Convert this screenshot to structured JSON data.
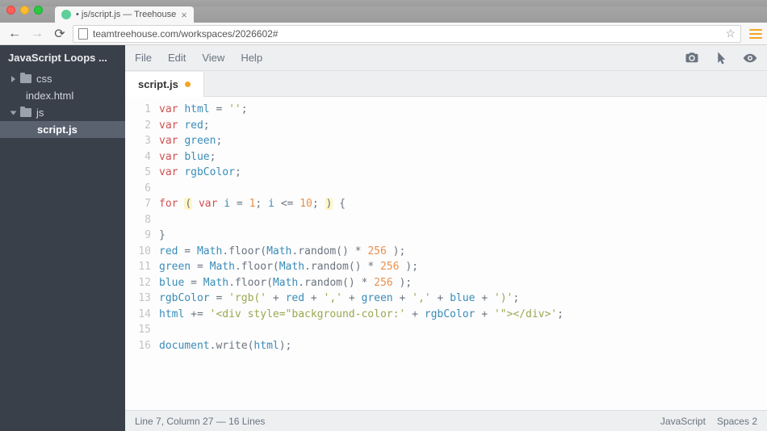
{
  "browser": {
    "tab_title": "• js/script.js — Treehouse",
    "url": "teamtreehouse.com/workspaces/2026602#"
  },
  "sidebar": {
    "project_name": "JavaScript Loops ...",
    "items": [
      {
        "label": "css",
        "type": "folder",
        "open": false
      },
      {
        "label": "index.html",
        "type": "file"
      },
      {
        "label": "js",
        "type": "folder",
        "open": true
      },
      {
        "label": "script.js",
        "type": "file",
        "nested": true,
        "selected": true
      }
    ]
  },
  "menubar": {
    "file": "File",
    "edit": "Edit",
    "view": "View",
    "help": "Help"
  },
  "file_tab": {
    "name": "script.js",
    "dirty": true
  },
  "code": {
    "lines": [
      [
        {
          "t": "var ",
          "c": "kw"
        },
        {
          "t": "html",
          "c": "var"
        },
        {
          "t": " = "
        },
        {
          "t": "''",
          "c": "str"
        },
        {
          "t": ";"
        }
      ],
      [
        {
          "t": "var ",
          "c": "kw"
        },
        {
          "t": "red",
          "c": "var"
        },
        {
          "t": ";"
        }
      ],
      [
        {
          "t": "var ",
          "c": "kw"
        },
        {
          "t": "green",
          "c": "var"
        },
        {
          "t": ";"
        }
      ],
      [
        {
          "t": "var ",
          "c": "kw"
        },
        {
          "t": "blue",
          "c": "var"
        },
        {
          "t": ";"
        }
      ],
      [
        {
          "t": "var ",
          "c": "kw"
        },
        {
          "t": "rgbColor",
          "c": "var"
        },
        {
          "t": ";"
        }
      ],
      [],
      [
        {
          "t": "for ",
          "c": "kw"
        },
        {
          "t": "(",
          "c": "paren-hl"
        },
        {
          "t": " "
        },
        {
          "t": "var ",
          "c": "kw"
        },
        {
          "t": "i",
          "c": "var"
        },
        {
          "t": " = "
        },
        {
          "t": "1",
          "c": "num"
        },
        {
          "t": "; "
        },
        {
          "t": "i",
          "c": "var"
        },
        {
          "t": " <= "
        },
        {
          "t": "10",
          "c": "num"
        },
        {
          "t": "; "
        },
        {
          "t": ")",
          "c": "paren-hl"
        },
        {
          "t": " {"
        }
      ],
      [],
      [
        {
          "t": "}"
        }
      ],
      [
        {
          "t": "red",
          "c": "var"
        },
        {
          "t": " = "
        },
        {
          "t": "Math",
          "c": "var"
        },
        {
          "t": ".floor("
        },
        {
          "t": "Math",
          "c": "var"
        },
        {
          "t": ".random() * "
        },
        {
          "t": "256",
          "c": "num"
        },
        {
          "t": " );"
        }
      ],
      [
        {
          "t": "green",
          "c": "var"
        },
        {
          "t": " = "
        },
        {
          "t": "Math",
          "c": "var"
        },
        {
          "t": ".floor("
        },
        {
          "t": "Math",
          "c": "var"
        },
        {
          "t": ".random() * "
        },
        {
          "t": "256",
          "c": "num"
        },
        {
          "t": " );"
        }
      ],
      [
        {
          "t": "blue",
          "c": "var"
        },
        {
          "t": " = "
        },
        {
          "t": "Math",
          "c": "var"
        },
        {
          "t": ".floor("
        },
        {
          "t": "Math",
          "c": "var"
        },
        {
          "t": ".random() * "
        },
        {
          "t": "256",
          "c": "num"
        },
        {
          "t": " );"
        }
      ],
      [
        {
          "t": "rgbColor",
          "c": "var"
        },
        {
          "t": " = "
        },
        {
          "t": "'rgb('",
          "c": "str"
        },
        {
          "t": " + "
        },
        {
          "t": "red",
          "c": "var"
        },
        {
          "t": " + "
        },
        {
          "t": "','",
          "c": "str"
        },
        {
          "t": " + "
        },
        {
          "t": "green",
          "c": "var"
        },
        {
          "t": " + "
        },
        {
          "t": "','",
          "c": "str"
        },
        {
          "t": " + "
        },
        {
          "t": "blue",
          "c": "var"
        },
        {
          "t": " + "
        },
        {
          "t": "')'",
          "c": "str"
        },
        {
          "t": ";"
        }
      ],
      [
        {
          "t": "html",
          "c": "var"
        },
        {
          "t": " += "
        },
        {
          "t": "'<div style=\"background-color:'",
          "c": "str"
        },
        {
          "t": " + "
        },
        {
          "t": "rgbColor",
          "c": "var"
        },
        {
          "t": " + "
        },
        {
          "t": "'\"></div>'",
          "c": "str"
        },
        {
          "t": ";"
        }
      ],
      [],
      [
        {
          "t": "document",
          "c": "var"
        },
        {
          "t": ".write("
        },
        {
          "t": "html",
          "c": "var"
        },
        {
          "t": ");"
        }
      ]
    ]
  },
  "statusbar": {
    "position": "Line 7, Column 27 — 16 Lines",
    "language": "JavaScript",
    "spaces": "Spaces  2"
  }
}
